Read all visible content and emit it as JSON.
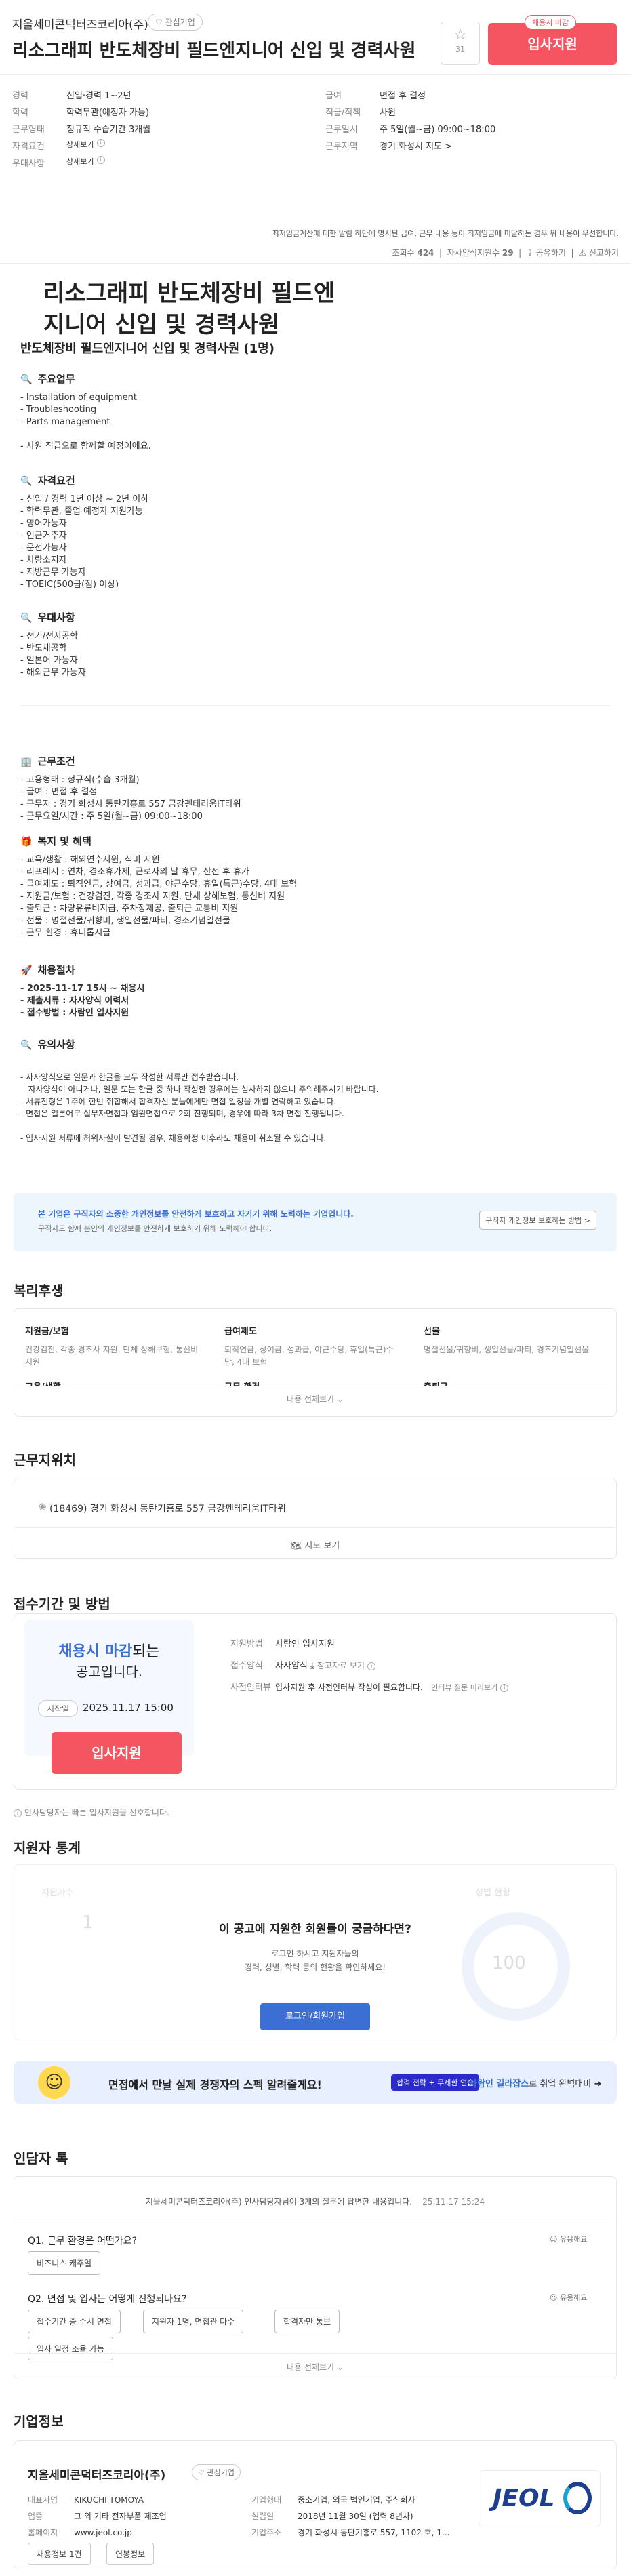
{
  "header": {
    "company": "지올세미콘덕터즈코리아(주)",
    "interest_label": "관심기업",
    "title": "리소그래피 반도체장비 필드엔지니어 신입 및 경력사원",
    "star_count": "31",
    "badge": "채용시 마감",
    "apply_label": "입사지원"
  },
  "summary": {
    "left": [
      {
        "k": "경력",
        "v": "신입·경력 1~2년"
      },
      {
        "k": "학력",
        "v": "학력무관(예정자 가능)"
      },
      {
        "k": "근무형태",
        "v": "정규직 수습기간 3개월"
      },
      {
        "k": "자격요건",
        "v": "상세보기"
      },
      {
        "k": "우대사항",
        "v": "상세보기"
      }
    ],
    "right": [
      {
        "k": "급여",
        "v": "면접 후 결정"
      },
      {
        "k": "직급/직책",
        "v": "사원"
      },
      {
        "k": "근무일시",
        "v": "주 5일(월~금) 09:00~18:00"
      },
      {
        "k": "근무지역",
        "v": "경기 화성시 지도 >"
      }
    ],
    "notice": "최저임금계산에 대한 알림 하단에 명시된 급여, 근무 내용 등이 최저임금에 미달하는 경우 위 내용이 우선합니다.",
    "views_label": "조회수",
    "views": "424",
    "applicants_label": "자사양식지원수",
    "applicants": "29",
    "share": "공유하기",
    "report": "신고하기"
  },
  "detail": {
    "big_title": "리소그래피 반도체장비 필드엔지니어 신입 및 경력사원",
    "sub_title": "반도체장비 필드엔지니어 신입 및 경력사원 (1명)",
    "duty_h": "주요업무",
    "duty": "- Installation of equipment\n- Troubleshooting\n- Parts management\n\n- 사원 직급으로 함께할 예정이에요.",
    "req_h": "자격요건",
    "req": "- 신입 / 경력 1년 이상 ~ 2년 이하\n- 학력무관, 졸업 예정자 지원가능\n- 영어가능자\n- 인근거주자\n- 운전가능자\n- 차량소지자\n- 지방근무 가능자\n- TOEIC(500급(점) 이상)",
    "pref_h": "우대사항",
    "pref": "- 전기/전자공학\n- 반도체공학\n- 일본어 가능자\n- 해외근무 가능자",
    "cond_h": "근무조건",
    "cond": "- 고용형태 : 정규직(수습 3개월)\n- 급여 : 면접 후 결정\n- 근무지 : 경기 화성시 동탄기흥로 557 금강펜테리움IT타워\n- 근무요일/시간 : 주 5일(월~금) 09:00~18:00",
    "welfare_h": "복지 및 혜택",
    "welfare": "- 교육/생활 : 해외연수지원, 식비 지원\n- 리프레시 : 연차, 경조휴가제, 근로자의 날 휴무, 산전 후 휴가\n- 급여제도 : 퇴직연금, 상여금, 성과급, 야근수당, 휴일(특근)수당, 4대 보험\n- 지원금/보험 : 건강검진, 각종 경조사 지원, 단체 상해보험, 통신비 지원\n- 출퇴근 : 차량유류비지급, 주차장제공, 출퇴근 교통비 지원\n- 선물 : 명절선물/귀향비, 생일선물/파티, 경조기념일선물\n- 근무 환경 : 휴니톱시급",
    "process_h": "채용절차",
    "process": "- 2025-11-17 15시 ~ 채용시\n- 제출서류 : 자사양식 이력서\n- 접수방법 : 사람인 입사지원",
    "note_h": "유의사항",
    "note": "- 자사양식으로 일문과 한글을 모두 작성한 서류만 접수받습니다.\n   자사양식이 아니거나, 일문 또는 한글 중 하나 작성한 경우에는 심사하지 않으니 주의해주시기 바랍니다.\n- 서류전형은 1주에 한번 취합해서 합격자신 분들에게만 면접 일정을 개별 연락하고 있습니다.\n- 면접은 일본어로 실무자면접과 임원면접으로 2회 진행되며, 경우에 따라 3차 면접 진행됩니다.\n\n- 입사지원 서류에 허위사실이 발견될 경우, 채용확정 이후라도 채용이 취소될 수 있습니다."
  },
  "privacy": {
    "title": "본 기업은 구직자의 소중한 개인정보를 안전하게 보호하고 자기기 위해 노력하는 기업입니다.",
    "desc": "구직자도 함께 본인의 개인정보를 안전하게 보호하기 위해 노력해야 합니다.",
    "button": "구직자 개인정보 보호하는 방법 >"
  },
  "welfare_sec": {
    "h": "복리후생",
    "cols": [
      {
        "k": "지원금/보험",
        "v": "건강검진, 각종 경조사 지원, 단체 상해보험, 통신비 지원"
      },
      {
        "k": "급여제도",
        "v": "퇴직연금, 상여금, 성과급, 야근수당, 휴일(특근)수당, 4대 보험"
      },
      {
        "k": "선물",
        "v": "명절선물/귀향비, 생일선물/파티, 경조기념일선물"
      }
    ],
    "cut1": "교육/생활",
    "cut2": "근무 환경",
    "cut3": "출퇴근",
    "more": "내용 전체보기"
  },
  "location": {
    "h": "근무지위치",
    "addr": "(18469) 경기 화성시 동탄기흥로 557 금강펜테리움IT타워",
    "map": "지도 보기"
  },
  "period": {
    "h": "접수기간 및 방법",
    "l1a": "채용시 마감",
    "l1b": "되는",
    "l2": "공고입니다.",
    "start": "시작일",
    "date": "2025.11.17 15:00",
    "apply": "입사지원",
    "method_k": "지원방법",
    "method_v": "사람인 입사지원",
    "form_k": "접수양식",
    "form_v": "자사양식",
    "form_more": "참고자료 보기",
    "pre_k": "사전인터뷰",
    "pre_v": "입사지원 후 사전인터뷰 작성이 필요합니다.",
    "pre_more": "인터뷰 질문 미리보기",
    "note": "인사담당자는 빠른 입사지원을 선호합니다."
  },
  "stats": {
    "h": "지원자 통계",
    "q": "이 공고에 지원한 회원들이 궁금하다면?",
    "d1": "로그인 하시고 지원자들의",
    "d2": "경력, 성별, 학력 등의 현황을 확인하세요!",
    "btn": "로그인/회원가입",
    "blur1": "지원자수",
    "blur2": "성별 현황",
    "blur3": "1",
    "blur4": "100"
  },
  "ad": {
    "txt": "면접에서 만날 실제 경쟁자의 스펙 알려줄게요!",
    "tag": "합격 전략 + 무제한 연습",
    "tail_b": "사람인 길라잡스",
    "tail": "로 취업 완벽대비"
  },
  "interview": {
    "h": "인담자 톡",
    "intro": "지올세미콘덕터즈코리아(주) 인사담당자님이 3개의 질문에 답변한 내용입니다.",
    "date": "25.11.17 15:24",
    "q1": "Q1. 근무 환경은 어떤가요?",
    "a1": "비즈니스 캐주얼",
    "q2": "Q2. 면접 및 입사는 어떻게 진행되나요?",
    "chips": [
      "접수기간 중 수시 면접",
      "지원자 1명, 면접관 다수",
      "합격자만 통보",
      "입사 일정 조율 가능"
    ],
    "useful": "유용해요",
    "more": "내용 전체보기"
  },
  "company": {
    "h": "기업정보",
    "name": "지올세미콘덕터즈코리아(주)",
    "interest": "관심기업",
    "ceo_k": "대표자명",
    "ceo_v": "KIKUCHI TOMOYA",
    "biz_k": "업종",
    "biz_v": "그 외 기타 전자부품 제조업",
    "home_k": "홈페이지",
    "home_v": "www.jeol.co.jp",
    "type_k": "기업형태",
    "type_v": "중소기업, 외국 법인기업, 주식회사",
    "est_k": "설립일",
    "est_v": "2018년 11월 30일 (업력 8년차)",
    "addr_k": "기업주소",
    "addr_v": "경기 화성시 동탄기흥로 557, 1102 호, 1...",
    "jobs": "채용정보 1건",
    "annual": "연봉정보",
    "logo": "JEOL"
  }
}
